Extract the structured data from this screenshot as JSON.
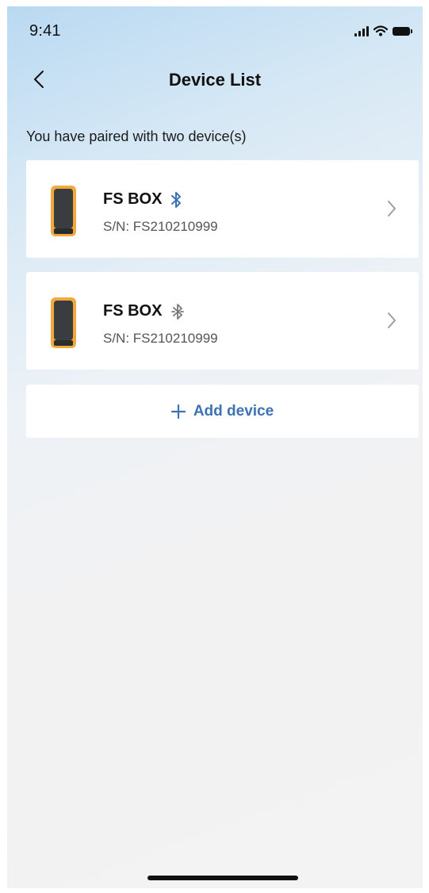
{
  "status_bar": {
    "time": "9:41"
  },
  "header": {
    "title": "Device List",
    "back_icon": "chevron-left-icon"
  },
  "subtitle": "You have paired with two device(s)",
  "devices": [
    {
      "name": "FS BOX",
      "serial": "S/N: FS210210999",
      "bluetooth_connected": true,
      "bluetooth_color": "#3d72b5"
    },
    {
      "name": "FS BOX",
      "serial": "S/N: FS210210999",
      "bluetooth_connected": false,
      "bluetooth_color": "#777777"
    }
  ],
  "add_device": {
    "label": "Add device",
    "icon": "plus-icon",
    "color": "#3d72b5"
  },
  "colors": {
    "device_body": "#f2a93b",
    "device_panel": "#3a3d40",
    "accent": "#3d72b5"
  }
}
